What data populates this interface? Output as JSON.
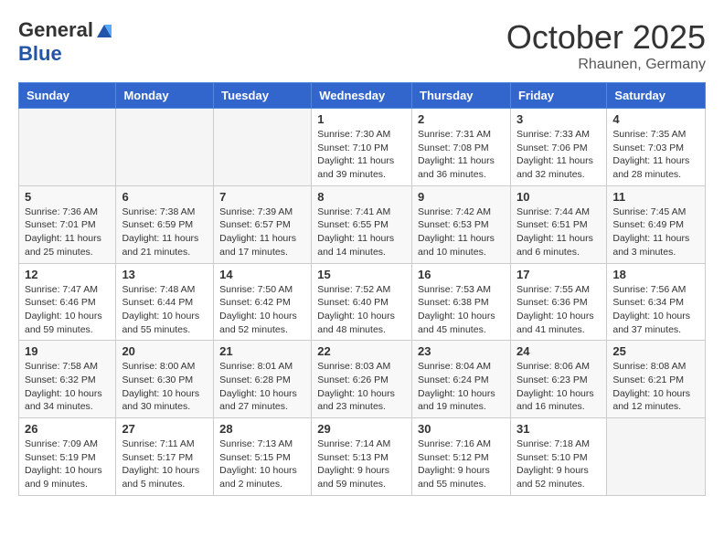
{
  "header": {
    "logo_general": "General",
    "logo_blue": "Blue",
    "month_title": "October 2025",
    "location": "Rhaunen, Germany"
  },
  "weekdays": [
    "Sunday",
    "Monday",
    "Tuesday",
    "Wednesday",
    "Thursday",
    "Friday",
    "Saturday"
  ],
  "weeks": [
    [
      {
        "day": "",
        "info": ""
      },
      {
        "day": "",
        "info": ""
      },
      {
        "day": "",
        "info": ""
      },
      {
        "day": "1",
        "info": "Sunrise: 7:30 AM\nSunset: 7:10 PM\nDaylight: 11 hours\nand 39 minutes."
      },
      {
        "day": "2",
        "info": "Sunrise: 7:31 AM\nSunset: 7:08 PM\nDaylight: 11 hours\nand 36 minutes."
      },
      {
        "day": "3",
        "info": "Sunrise: 7:33 AM\nSunset: 7:06 PM\nDaylight: 11 hours\nand 32 minutes."
      },
      {
        "day": "4",
        "info": "Sunrise: 7:35 AM\nSunset: 7:03 PM\nDaylight: 11 hours\nand 28 minutes."
      }
    ],
    [
      {
        "day": "5",
        "info": "Sunrise: 7:36 AM\nSunset: 7:01 PM\nDaylight: 11 hours\nand 25 minutes."
      },
      {
        "day": "6",
        "info": "Sunrise: 7:38 AM\nSunset: 6:59 PM\nDaylight: 11 hours\nand 21 minutes."
      },
      {
        "day": "7",
        "info": "Sunrise: 7:39 AM\nSunset: 6:57 PM\nDaylight: 11 hours\nand 17 minutes."
      },
      {
        "day": "8",
        "info": "Sunrise: 7:41 AM\nSunset: 6:55 PM\nDaylight: 11 hours\nand 14 minutes."
      },
      {
        "day": "9",
        "info": "Sunrise: 7:42 AM\nSunset: 6:53 PM\nDaylight: 11 hours\nand 10 minutes."
      },
      {
        "day": "10",
        "info": "Sunrise: 7:44 AM\nSunset: 6:51 PM\nDaylight: 11 hours\nand 6 minutes."
      },
      {
        "day": "11",
        "info": "Sunrise: 7:45 AM\nSunset: 6:49 PM\nDaylight: 11 hours\nand 3 minutes."
      }
    ],
    [
      {
        "day": "12",
        "info": "Sunrise: 7:47 AM\nSunset: 6:46 PM\nDaylight: 10 hours\nand 59 minutes."
      },
      {
        "day": "13",
        "info": "Sunrise: 7:48 AM\nSunset: 6:44 PM\nDaylight: 10 hours\nand 55 minutes."
      },
      {
        "day": "14",
        "info": "Sunrise: 7:50 AM\nSunset: 6:42 PM\nDaylight: 10 hours\nand 52 minutes."
      },
      {
        "day": "15",
        "info": "Sunrise: 7:52 AM\nSunset: 6:40 PM\nDaylight: 10 hours\nand 48 minutes."
      },
      {
        "day": "16",
        "info": "Sunrise: 7:53 AM\nSunset: 6:38 PM\nDaylight: 10 hours\nand 45 minutes."
      },
      {
        "day": "17",
        "info": "Sunrise: 7:55 AM\nSunset: 6:36 PM\nDaylight: 10 hours\nand 41 minutes."
      },
      {
        "day": "18",
        "info": "Sunrise: 7:56 AM\nSunset: 6:34 PM\nDaylight: 10 hours\nand 37 minutes."
      }
    ],
    [
      {
        "day": "19",
        "info": "Sunrise: 7:58 AM\nSunset: 6:32 PM\nDaylight: 10 hours\nand 34 minutes."
      },
      {
        "day": "20",
        "info": "Sunrise: 8:00 AM\nSunset: 6:30 PM\nDaylight: 10 hours\nand 30 minutes."
      },
      {
        "day": "21",
        "info": "Sunrise: 8:01 AM\nSunset: 6:28 PM\nDaylight: 10 hours\nand 27 minutes."
      },
      {
        "day": "22",
        "info": "Sunrise: 8:03 AM\nSunset: 6:26 PM\nDaylight: 10 hours\nand 23 minutes."
      },
      {
        "day": "23",
        "info": "Sunrise: 8:04 AM\nSunset: 6:24 PM\nDaylight: 10 hours\nand 19 minutes."
      },
      {
        "day": "24",
        "info": "Sunrise: 8:06 AM\nSunset: 6:23 PM\nDaylight: 10 hours\nand 16 minutes."
      },
      {
        "day": "25",
        "info": "Sunrise: 8:08 AM\nSunset: 6:21 PM\nDaylight: 10 hours\nand 12 minutes."
      }
    ],
    [
      {
        "day": "26",
        "info": "Sunrise: 7:09 AM\nSunset: 5:19 PM\nDaylight: 10 hours\nand 9 minutes."
      },
      {
        "day": "27",
        "info": "Sunrise: 7:11 AM\nSunset: 5:17 PM\nDaylight: 10 hours\nand 5 minutes."
      },
      {
        "day": "28",
        "info": "Sunrise: 7:13 AM\nSunset: 5:15 PM\nDaylight: 10 hours\nand 2 minutes."
      },
      {
        "day": "29",
        "info": "Sunrise: 7:14 AM\nSunset: 5:13 PM\nDaylight: 9 hours\nand 59 minutes."
      },
      {
        "day": "30",
        "info": "Sunrise: 7:16 AM\nSunset: 5:12 PM\nDaylight: 9 hours\nand 55 minutes."
      },
      {
        "day": "31",
        "info": "Sunrise: 7:18 AM\nSunset: 5:10 PM\nDaylight: 9 hours\nand 52 minutes."
      },
      {
        "day": "",
        "info": ""
      }
    ]
  ]
}
